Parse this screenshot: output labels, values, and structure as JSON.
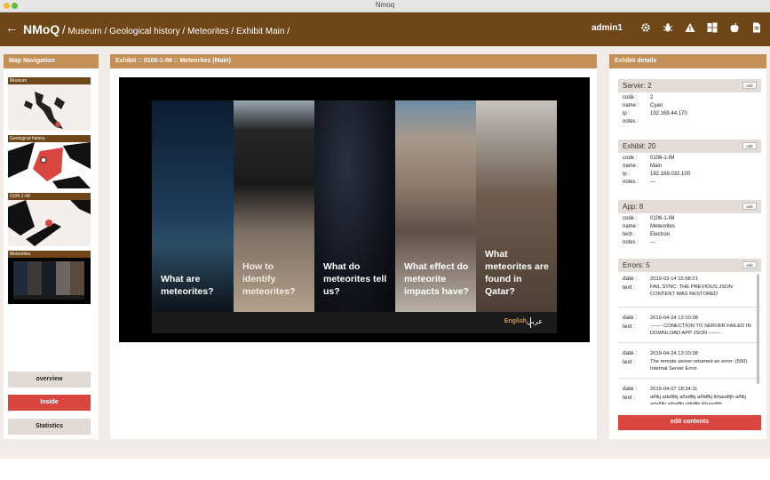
{
  "window": {
    "title": "Nmoq"
  },
  "header": {
    "brand": "NMoQ",
    "sep": "/",
    "crumbs": [
      {
        "label": "Museum"
      },
      {
        "label": "Geological history"
      },
      {
        "label": "Meteorites"
      },
      {
        "label": "Exhibit Main"
      }
    ],
    "user": "admin1",
    "icons": [
      "gear-icon",
      "bug-icon",
      "warning-icon",
      "windows-icon",
      "apple-icon",
      "file-icon"
    ]
  },
  "left_panel": {
    "title": "Map Navigation",
    "maps": [
      {
        "label": "Museum"
      },
      {
        "label": "Geological history"
      },
      {
        "label": "0106-1-IM"
      },
      {
        "label": "Meteorites"
      }
    ],
    "buttons": [
      {
        "label": "overview"
      },
      {
        "label": "Inside"
      },
      {
        "label": "Statistics"
      }
    ]
  },
  "center_panel": {
    "title": "Exhibit :: 0106-1-IM :: Meteorites (Main)",
    "screen": {
      "strips": [
        {
          "text": "What are meteorites?"
        },
        {
          "text": "How to identify meteorites?"
        },
        {
          "text": "What do meteorites tell us?"
        },
        {
          "text": "What effect do meteorite impacts have?"
        },
        {
          "text": "What meteorites are found in Qatar?"
        }
      ],
      "lang_en": "English",
      "lang_ar": "عربي"
    }
  },
  "right_panel": {
    "title": "Exhibit details",
    "edit_label": "edit",
    "server": {
      "label": "Server:",
      "count": "2",
      "fields": {
        "code_k": "code :",
        "code": "2",
        "name_k": "name :",
        "name": "Cyan",
        "ip_k": "ip :",
        "ip": "192.168.44.170",
        "notes_k": "notes :",
        "notes": ""
      }
    },
    "exhibit": {
      "label": "Exhibit:",
      "count": "20",
      "fields": {
        "code_k": "code :",
        "code": "0106-1-IM",
        "name_k": "name :",
        "name": "Main",
        "ip_k": "ip :",
        "ip": "192.168.032.100",
        "notes_k": "notes :",
        "notes": "---"
      }
    },
    "app": {
      "label": "App:",
      "count": "8",
      "fields": {
        "code_k": "code :",
        "code": "0106-1-IM",
        "name_k": "name :",
        "name": "Meteorites",
        "tech_k": "tech :",
        "tech": "Electron",
        "notes_k": "notes :",
        "notes": "---"
      }
    },
    "errors": {
      "label": "Errors:",
      "count": "5",
      "date_k": "date :",
      "text_k": "text :",
      "items": [
        {
          "date": "2019-03-14 15:58:21",
          "text": "FAIL SYNC: THE PREVIOUS JSON CONTENT WAS RESTORED"
        },
        {
          "date": "2019-04-24 13:10:38",
          "text": "------- CONECTION TO SERVER FAILED IN DOWNLOAD APP JSON -------"
        },
        {
          "date": "2019-04-24 13:10:38",
          "text": "The remote server returned an error: (500) Internal Server Error."
        },
        {
          "date": "2019-04-07 18:24:11",
          "text": "añlkj adsñlkj añsdfkj añldfkj lkhasdfjh añlkj adsñlkj añsdfkj añldfkj lkhasdfjh"
        }
      ]
    },
    "edit_contents": "edit contents"
  },
  "colors": {
    "header_brown": "#6e4618",
    "panel_tan": "#c58f58",
    "accent_red": "#d8463f",
    "lang_orange": "#d9973b",
    "page_bg": "#f2ece8"
  }
}
